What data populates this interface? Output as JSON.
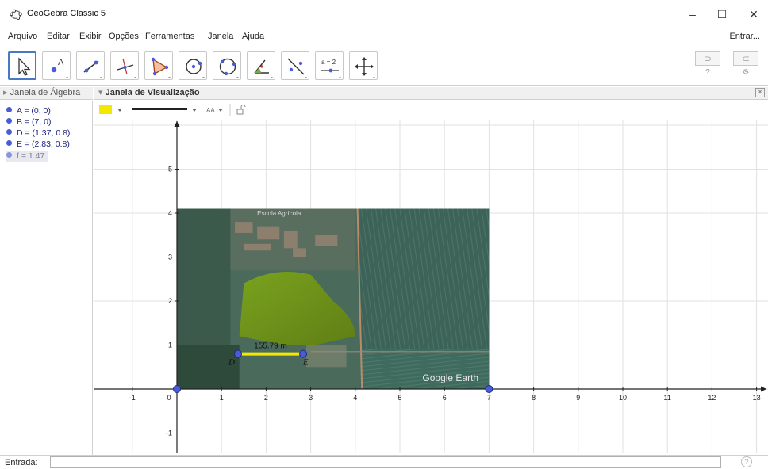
{
  "window": {
    "title": "GeoGebra Classic 5",
    "minimize": "–",
    "maximize": "☐",
    "close": "✕"
  },
  "menu": {
    "items": [
      "Arquivo",
      "Editar",
      "Exibir",
      "Opções",
      "Ferramentas",
      "Janela",
      "Ajuda"
    ],
    "signin": "Entrar..."
  },
  "toolbar": {
    "tools": [
      "move-tool",
      "point-tool",
      "line-tool",
      "perpendicular-line-tool",
      "polygon-tool",
      "circle-tool",
      "circle-three-points-tool",
      "angle-tool",
      "reflect-tool",
      "slider-tool",
      "move-graphics-view-tool"
    ],
    "slider_label": "a = 2",
    "undo": "⊃",
    "redo": "⊂",
    "help": "?",
    "settings": "⚙"
  },
  "algebra": {
    "header": "Janela de Álgebra",
    "items": [
      {
        "text": "A = (0, 0)",
        "highlighted": false
      },
      {
        "text": "B = (7, 0)",
        "highlighted": false
      },
      {
        "text": "D = (1.37, 0.8)",
        "highlighted": false
      },
      {
        "text": "E = (2.83, 0.8)",
        "highlighted": false
      },
      {
        "text": "f = 1.47",
        "highlighted": true
      }
    ]
  },
  "graphics": {
    "header": "Janela de Visualização",
    "style_bar": {
      "color": "#f5e800",
      "font_label": "AA"
    },
    "x_ticks": [
      "-1",
      "0",
      "1",
      "2",
      "3",
      "4",
      "5",
      "6",
      "7",
      "8",
      "9",
      "10",
      "11",
      "12",
      "13"
    ],
    "y_ticks": [
      "-1",
      "1",
      "2",
      "3",
      "4",
      "5"
    ],
    "image_label": "Google Earth",
    "image_caption": "Escola Agrícola",
    "segment_label": "155.79 m",
    "points": [
      {
        "name": "A",
        "x": 0,
        "y": 0,
        "show_label": false
      },
      {
        "name": "B",
        "x": 7,
        "y": 0,
        "show_label": false
      },
      {
        "name": "D",
        "x": 1.37,
        "y": 0.8,
        "show_label": true
      },
      {
        "name": "E",
        "x": 2.83,
        "y": 0.8,
        "show_label": true
      }
    ]
  },
  "input": {
    "label": "Entrada:",
    "value": "",
    "help": "?"
  },
  "colors": {
    "point": "#4a5bd6",
    "segment": "#f5e800",
    "field": "#6f8f1a",
    "accent": "#4a78c2"
  }
}
